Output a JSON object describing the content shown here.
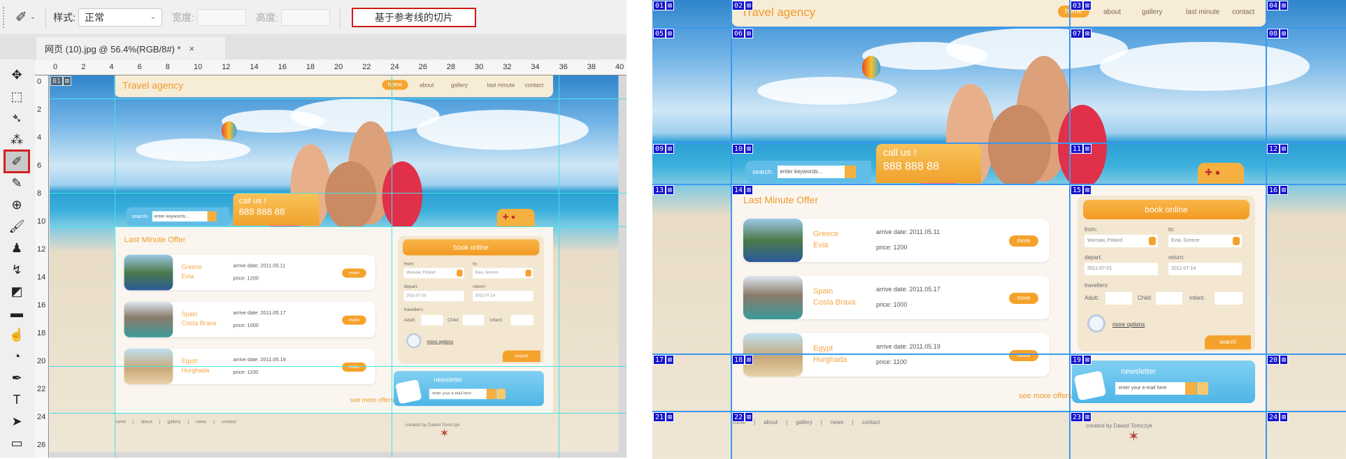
{
  "options_bar": {
    "style_label": "样式:",
    "style_value": "正常",
    "width_label": "宽度:",
    "height_label": "高度:",
    "slices_from_guides": "基于参考线的切片"
  },
  "document_tab": {
    "title": "网页 (10).jpg @ 56.4%(RGB/8#) *",
    "close": "×",
    "panel_toggle": "▸▸"
  },
  "tools": [
    {
      "name": "move",
      "glyph": "✥"
    },
    {
      "name": "marquee",
      "glyph": "⬚"
    },
    {
      "name": "lasso",
      "glyph": "➴"
    },
    {
      "name": "magic-wand",
      "glyph": "⁂"
    },
    {
      "name": "slice",
      "glyph": "✐",
      "active": true
    },
    {
      "name": "eyedropper",
      "glyph": "✎"
    },
    {
      "name": "healing",
      "glyph": "⊕"
    },
    {
      "name": "brush",
      "glyph": "🖌"
    },
    {
      "name": "stamp",
      "glyph": "♟"
    },
    {
      "name": "history-brush",
      "glyph": "↯"
    },
    {
      "name": "eraser",
      "glyph": "◩"
    },
    {
      "name": "gradient",
      "glyph": "▬"
    },
    {
      "name": "blur",
      "glyph": "☝"
    },
    {
      "name": "dodge",
      "glyph": "◔"
    },
    {
      "name": "pen",
      "glyph": "✒"
    },
    {
      "name": "type",
      "glyph": "T"
    },
    {
      "name": "path-select",
      "glyph": "➤"
    },
    {
      "name": "rectangle",
      "glyph": "▭"
    }
  ],
  "ruler_h": [
    "0",
    "2",
    "4",
    "6",
    "8",
    "10",
    "12",
    "14",
    "16",
    "18",
    "20",
    "22",
    "24",
    "26",
    "28",
    "30",
    "32",
    "34",
    "36",
    "38",
    "40"
  ],
  "ruler_v": [
    "0",
    "2",
    "4",
    "6",
    "8",
    "10",
    "12",
    "14",
    "16",
    "18",
    "20",
    "22",
    "24",
    "26"
  ],
  "site": {
    "logo": "Travel agency",
    "nav": [
      "home",
      "about",
      "gallery",
      "last minute",
      "contact"
    ],
    "search_label": "search:",
    "search_placeholder": "enter keywords...",
    "call_title": "call us !",
    "phone": "888 888 88",
    "flags": "✚ ●",
    "lmo_title": "Last Minute Offer",
    "offers": [
      {
        "name": "Greece",
        "place": "Evia",
        "arrive": "arrive date: 2011.05.11",
        "price": "price: 1200",
        "more": "more"
      },
      {
        "name": "Spain",
        "place": "Costa Brava",
        "arrive": "arrive date: 2011.05.17",
        "price": "price: 1000",
        "more": "more"
      },
      {
        "name": "Egypt",
        "place": "Hurghada",
        "arrive": "arrive date: 2011.05.19",
        "price": "price: 1100",
        "more": "more"
      }
    ],
    "see_more": "see more offers",
    "book": {
      "title": "book online",
      "from": "from:",
      "to": "to:",
      "from_val": "Warsaw, Poland",
      "to_val": "Evia, Greece",
      "depart": "depart:",
      "return": "return:",
      "depart_val": "2011-07-01",
      "return_val": "2011-07-14",
      "travellers": "travellers:",
      "adult": "Adult:",
      "child": "Child:",
      "infant": "Infant:",
      "more_options": "more options",
      "search": "search"
    },
    "newsletter": {
      "title": "newsletter",
      "placeholder": "enter your e-mail here"
    },
    "footer": [
      "home",
      "|",
      "about",
      "|",
      "gallery",
      "|",
      "news",
      "|",
      "contact"
    ],
    "credit": "created by Dawid Tomczyk"
  },
  "slices": [
    "01",
    "02",
    "03",
    "04",
    "05",
    "06",
    "07",
    "08",
    "09",
    "10",
    "11",
    "12",
    "13",
    "14",
    "15",
    "16",
    "17",
    "18",
    "19",
    "20",
    "21",
    "22",
    "23",
    "24"
  ],
  "slice_icon": "⊠"
}
